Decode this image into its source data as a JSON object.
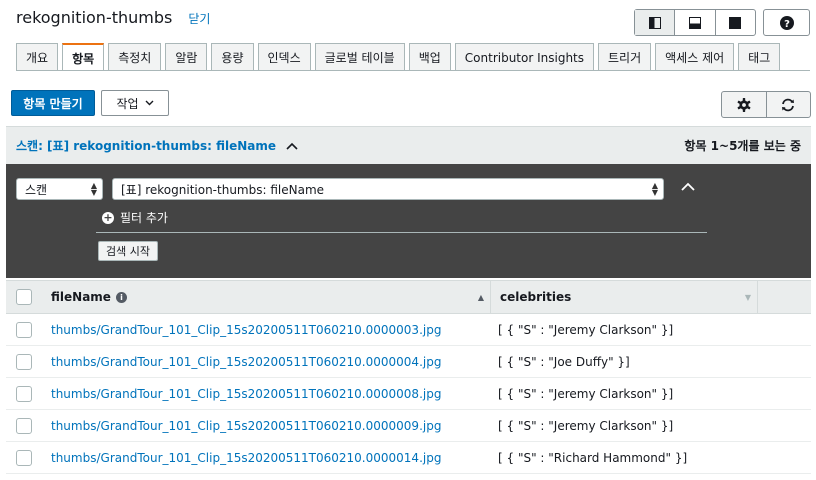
{
  "header": {
    "table_name": "rekognition-thumbs",
    "close_label": "닫기"
  },
  "tabs": [
    "개요",
    "항목",
    "측정치",
    "알람",
    "용량",
    "인덱스",
    "글로벌 테이블",
    "백업",
    "Contributor Insights",
    "트리거",
    "액세스 제어",
    "태그"
  ],
  "active_tab": "항목",
  "toolbar": {
    "create_item_label": "항목 만들기",
    "actions_label": "작업"
  },
  "scan": {
    "summary": "스캔: [표] rekognition-thumbs: fileName",
    "range": "항목 1~5개를 보는 중",
    "mode": "스캔",
    "target": "[표] rekognition-thumbs: fileName",
    "add_filter_label": "필터 추가",
    "start_search_label": "검색 시작"
  },
  "columns": {
    "file_name": "fileName",
    "celebrities": "celebrities"
  },
  "rows": [
    {
      "file_name": "thumbs/GrandTour_101_Clip_15s20200511T060210.0000003.jpg",
      "celebrities": "[ { \"S\" : \"Jeremy Clarkson\" }]"
    },
    {
      "file_name": "thumbs/GrandTour_101_Clip_15s20200511T060210.0000004.jpg",
      "celebrities": "[ { \"S\" : \"Joe Duffy\" }]"
    },
    {
      "file_name": "thumbs/GrandTour_101_Clip_15s20200511T060210.0000008.jpg",
      "celebrities": "[ { \"S\" : \"Jeremy Clarkson\" }]"
    },
    {
      "file_name": "thumbs/GrandTour_101_Clip_15s20200511T060210.0000009.jpg",
      "celebrities": "[ { \"S\" : \"Jeremy Clarkson\" }]"
    },
    {
      "file_name": "thumbs/GrandTour_101_Clip_15s20200511T060210.0000014.jpg",
      "celebrities": "[ { \"S\" : \"Richard Hammond\" }]"
    }
  ],
  "colors": {
    "accent": "#0073bb",
    "tab_highlight": "#ec7211",
    "panel": "#444444"
  }
}
